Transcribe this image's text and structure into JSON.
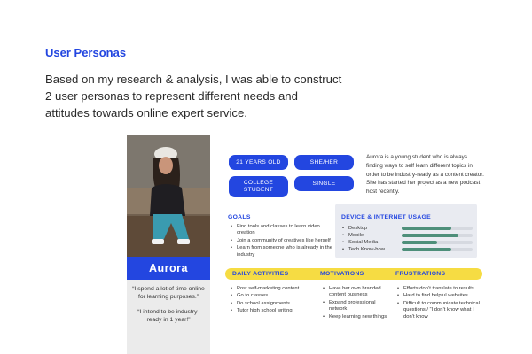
{
  "header": {
    "title": "User Personas",
    "intro_lines": [
      "Based on my research & analysis, I was able to construct",
      "2 user personas to represent different needs and",
      "attitudes towards online expert service."
    ]
  },
  "persona": {
    "name": "Aurora",
    "quotes": [
      "“I spend a lot of time online for learning purposes.”",
      "“I intend to be industry-ready in 1 year!”"
    ],
    "tags": [
      "21 YEARS OLD",
      "SHE/HER",
      "COLLEGE STUDENT",
      "SINGLE"
    ],
    "bio": "Aurora is a young student who is always finding ways to self learn different topics in order to be industry-ready as a content creator. She has started her project as a new podcast host recently.",
    "goals": {
      "title": "GOALS",
      "items": [
        "Find tools and classes to learn video creation",
        "Join a community of creatives like herself",
        "Learn from someone who is already in the industry"
      ]
    },
    "device_usage": {
      "title": "DEVICE & INTERNET USAGE",
      "items": [
        {
          "label": "Desktop",
          "level": 0.7
        },
        {
          "label": "Mobile",
          "level": 0.8
        },
        {
          "label": "Social Media",
          "level": 0.5
        },
        {
          "label": "Tech Know-how",
          "level": 0.7
        }
      ]
    },
    "daily_activities": {
      "title": "DAILY ACTIVITIES",
      "items": [
        "Post self-marketing content",
        "Go to classes",
        "Do school assignments",
        "Tutor high school writing"
      ]
    },
    "motivations": {
      "title": "MOTIVATIONS",
      "items": [
        "Have her own branded content business",
        "Expand professional network",
        "Keep learning new things"
      ]
    },
    "frustrations": {
      "title": "FRUSTRATIONS",
      "items": [
        "Efforts don’t translate to results",
        "Hard to find helpful websites",
        "Difficult to communicate technical questions / “I don’t know what I don’t know"
      ]
    }
  },
  "colors": {
    "accent": "#2346e0",
    "highlight": "#f6dc43",
    "bar_fill": "#4e8f7a",
    "panel": "#e9ebf1"
  }
}
